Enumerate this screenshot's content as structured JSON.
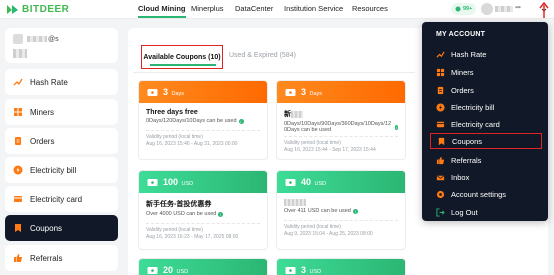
{
  "brand": {
    "name": "BITDEER"
  },
  "top_nav": [
    {
      "label": "Cloud Mining",
      "active": true
    },
    {
      "label": "Minerplus",
      "active": false
    },
    {
      "label": "DataCenter",
      "active": false
    },
    {
      "label": "Institution Service",
      "active": false
    },
    {
      "label": "Resources",
      "active": false
    }
  ],
  "header": {
    "vip_label": "99+",
    "username_suffix": "***"
  },
  "sidebar": {
    "user_suffix": "@s",
    "items": [
      {
        "label": "Hash Rate",
        "icon": "chart-line-icon"
      },
      {
        "label": "Miners",
        "icon": "grid-icon"
      },
      {
        "label": "Orders",
        "icon": "orders-icon"
      },
      {
        "label": "Electricity bill",
        "icon": "electricity-icon"
      },
      {
        "label": "Electricity card",
        "icon": "card-icon"
      },
      {
        "label": "Coupons",
        "icon": "coupon-icon",
        "active": true
      },
      {
        "label": "Referrals",
        "icon": "thumb-up-icon"
      }
    ]
  },
  "tabs": {
    "available": "Available Coupons (10)",
    "expired": "Used & Expired (584)"
  },
  "coupons": [
    {
      "color": "orange",
      "amount": "3",
      "unit": "Days",
      "title": "Three days free",
      "desc": "0Days/120Days/10Days can be used",
      "validity_label": "Validity period (local time)",
      "validity_dates": "Aug 16, 2023 15:46 - Aug 31, 2023 00:00"
    },
    {
      "color": "orange",
      "amount": "3",
      "unit": "Days",
      "title": "新",
      "desc": "0Days/10Days/90Days/360Days/10Days/12 0Days can be used",
      "validity_label": "Validity period (local time)",
      "validity_dates": "Aug 16, 2023 15:44 - Sep 17, 2023 15:44"
    },
    {
      "color": "green",
      "amount": "100",
      "unit": "USD",
      "title": "新手任务-首投优惠券",
      "desc": "Over 4000 USD can be used",
      "validity_label": "Validity period (local time)",
      "validity_dates": "Aug 16, 2023 16:23 - May 17, 2025 08:00"
    },
    {
      "color": "green",
      "amount": "40",
      "unit": "USD",
      "title": "",
      "desc": "Over 411 USD can be used",
      "validity_label": "Validity period (local time)",
      "validity_dates": "Aug 9, 2023 15:04 - Aug 25, 2023 08:00"
    },
    {
      "color": "green",
      "amount": "20",
      "unit": "USD",
      "title": "",
      "desc": "",
      "validity_label": "",
      "validity_dates": ""
    },
    {
      "color": "green",
      "amount": "3",
      "unit": "USD",
      "title": "",
      "desc": "",
      "validity_label": "",
      "validity_dates": ""
    }
  ],
  "dropdown": {
    "title": "MY ACCOUNT",
    "items": [
      {
        "label": "Hash Rate",
        "icon": "chart-line-icon"
      },
      {
        "label": "Miners",
        "icon": "grid-icon"
      },
      {
        "label": "Orders",
        "icon": "orders-icon"
      },
      {
        "label": "Electricity bill",
        "icon": "electricity-icon"
      },
      {
        "label": "Electricity card",
        "icon": "card-icon"
      },
      {
        "label": "Coupons",
        "icon": "coupon-icon",
        "highlighted": true
      },
      {
        "label": "Referrals",
        "icon": "thumb-up-icon"
      },
      {
        "label": "Inbox",
        "icon": "inbox-icon"
      },
      {
        "label": "Account settings",
        "icon": "gear-icon"
      },
      {
        "label": "Log Out",
        "icon": "logout-icon"
      }
    ]
  },
  "colors": {
    "accent": "#2bb673",
    "orange": "#ff7a12",
    "dark": "#111827",
    "highlight": "#e02424"
  }
}
